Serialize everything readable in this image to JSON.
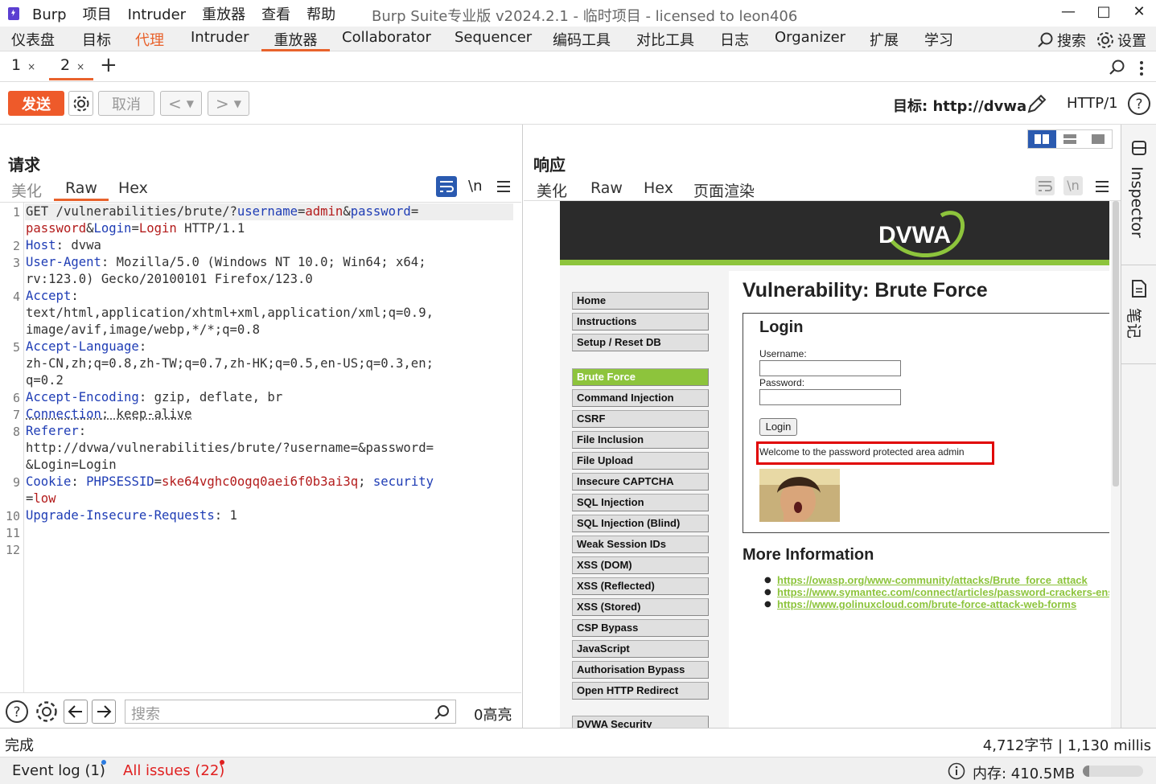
{
  "title_bar": {
    "menus": [
      "Burp",
      "项目",
      "Intruder",
      "重放器",
      "查看",
      "帮助"
    ],
    "window_title": "Burp Suite专业版  v2024.2.1 - 临时项目 - licensed to leon406"
  },
  "main_nav": {
    "tabs": [
      "仪表盘",
      "目标",
      "代理",
      "Intruder",
      "重放器",
      "Collaborator",
      "Sequencer",
      "编码工具",
      "对比工具",
      "日志",
      "Organizer",
      "扩展",
      "学习"
    ],
    "active": "重放器",
    "search_label": "搜索",
    "settings_label": "设置"
  },
  "repeater_tabs": {
    "tabs": [
      {
        "label": "1"
      },
      {
        "label": "2"
      }
    ],
    "active": "2",
    "close_glyph": "×",
    "add_glyph": "+"
  },
  "toolbar": {
    "send_label": "发送",
    "cancel_label": "取消",
    "target_label": "目标: http://dvwa",
    "protocol": "HTTP/1"
  },
  "request": {
    "title": "请求",
    "tabs": [
      "美化",
      "Raw",
      "Hex"
    ],
    "active_tab": "Raw",
    "newline_label": "\\n",
    "line_numbers": [
      "1",
      "2",
      "3",
      "4",
      "5",
      "6",
      "7",
      "8",
      "9",
      "10",
      "11",
      "12"
    ],
    "search_placeholder": "搜索",
    "highlights": "0高亮"
  },
  "response": {
    "title": "响应",
    "tabs": [
      "美化",
      "Raw",
      "Hex",
      "页面渲染"
    ],
    "active_tab": "页面渲染",
    "newline_label": "\\n"
  },
  "dvwa": {
    "logo": "DVWA",
    "menu": [
      "Home",
      "Instructions",
      "Setup / Reset DB",
      "Brute Force",
      "Command Injection",
      "CSRF",
      "File Inclusion",
      "File Upload",
      "Insecure CAPTCHA",
      "SQL Injection",
      "SQL Injection (Blind)",
      "Weak Session IDs",
      "XSS (DOM)",
      "XSS (Reflected)",
      "XSS (Stored)",
      "CSP Bypass",
      "JavaScript",
      "Authorisation Bypass",
      "Open HTTP Redirect",
      "DVWA Security"
    ],
    "selected_menu": "Brute Force",
    "heading": "Vulnerability: Brute Force",
    "login_title": "Login",
    "username_label": "Username:",
    "password_label": "Password:",
    "login_button": "Login",
    "welcome_message": "Welcome to the password protected area admin",
    "more_info_title": "More Information",
    "links": [
      "https://owasp.org/www-community/attacks/Brute_force_attack",
      "https://www.symantec.com/connect/articles/password-crackers-ens",
      "https://www.golinuxcloud.com/brute-force-attack-web-forms"
    ]
  },
  "sidebar": {
    "inspector_label": "Inspector",
    "notes_label": "笔记"
  },
  "status": {
    "left": "完成",
    "right": "4,712字节 | 1,130 millis"
  },
  "bottom": {
    "event_log": "Event log (1)",
    "all_issues": "All issues (22)",
    "memory": "内存: 410.5MB"
  },
  "colors": {
    "accent": "#e8622c",
    "send_button": "#ee5a2a",
    "dvwa_green": "#8dc43c",
    "highlight_box": "#e00000"
  }
}
